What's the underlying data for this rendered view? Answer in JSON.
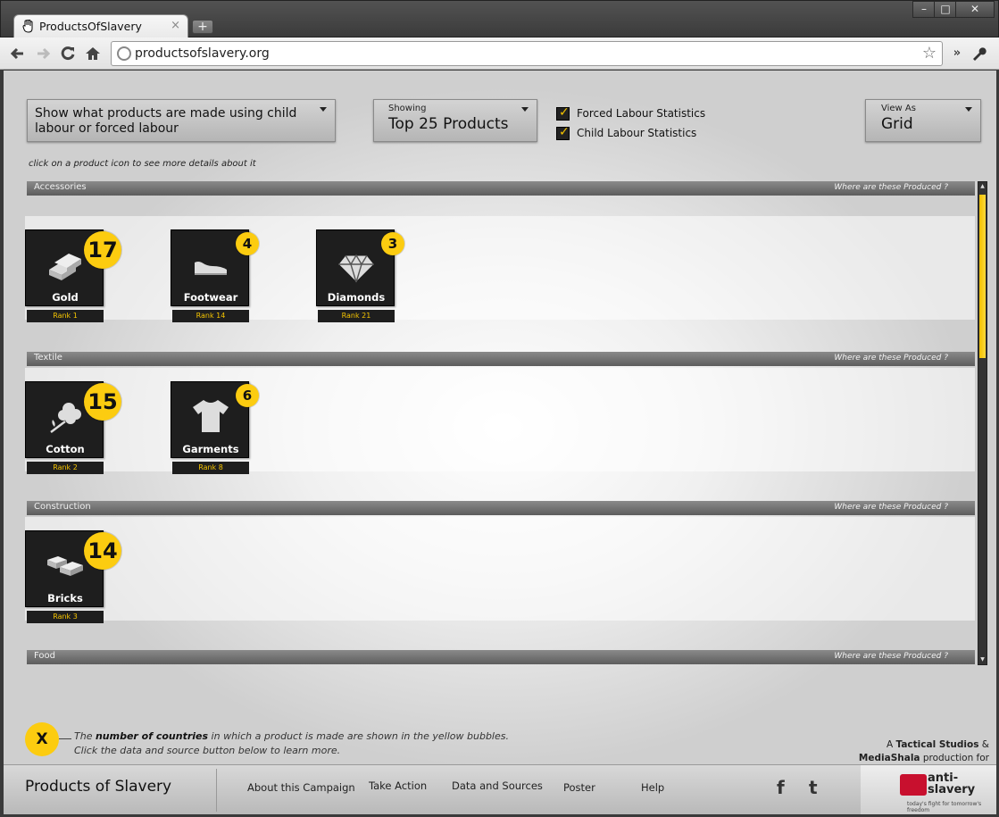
{
  "browser": {
    "tab_title": "ProductsOfSlavery",
    "tab_close": "×",
    "new_tab": "+",
    "url": "productsofslavery.org",
    "win_min": "–",
    "win_max": "□",
    "win_close": "✕"
  },
  "controls": {
    "main_dropdown": "Show what products are made using child labour or forced labour",
    "showing_label": "Showing",
    "showing_value": "Top 25 Products",
    "view_label": "View As",
    "view_value": "Grid",
    "checkbox_forced": "Forced Labour Statistics",
    "checkbox_child": "Child Labour Statistics",
    "hint": "click on a product icon to see more details about it"
  },
  "categories": [
    {
      "name": "Accessories",
      "where": "Where are these Produced ?",
      "products": [
        {
          "name": "Gold",
          "count": "17",
          "rank": "Rank   1",
          "icon": "gold-bars-icon"
        },
        {
          "name": "Footwear",
          "count": "4",
          "rank": "Rank   14",
          "icon": "shoe-icon"
        },
        {
          "name": "Diamonds",
          "count": "3",
          "rank": "Rank   21",
          "icon": "diamond-icon"
        }
      ]
    },
    {
      "name": "Textile",
      "where": "Where are these Produced ?",
      "products": [
        {
          "name": "Cotton",
          "count": "15",
          "rank": "Rank   2",
          "icon": "cotton-icon"
        },
        {
          "name": "Garments",
          "count": "6",
          "rank": "Rank   8",
          "icon": "tshirt-icon"
        }
      ]
    },
    {
      "name": "Construction",
      "where": "Where are these Produced ?",
      "products": [
        {
          "name": "Bricks",
          "count": "14",
          "rank": "Rank   3",
          "icon": "bricks-icon"
        }
      ]
    },
    {
      "name": "Food",
      "where": "Where are these Produced ?",
      "products": []
    }
  ],
  "legend": {
    "symbol": "X",
    "line1_pre": "The ",
    "line1_bold": "number of countries",
    "line1_post": " in which a product is made are shown in the yellow bubbles.",
    "line2": "Click the data and source button below to learn more."
  },
  "credit": {
    "pre": "A ",
    "studio": "Tactical Studios",
    "amp": " &",
    "partner": "MediaShala",
    "post": " production for"
  },
  "footer": {
    "brand": "Products of Slavery",
    "nav": [
      "About this Campaign",
      "Take Action",
      "Data and Sources",
      "Poster",
      "Help"
    ],
    "facebook": "f",
    "twitter": "t",
    "logo_text_1": "anti-",
    "logo_text_2": "slavery",
    "logo_tagline": "today's fight for tomorrow's freedom"
  },
  "colors": {
    "accent_yellow": "#fccc10",
    "tile_dark": "#1e1e1e",
    "logo_red": "#c8102e"
  }
}
